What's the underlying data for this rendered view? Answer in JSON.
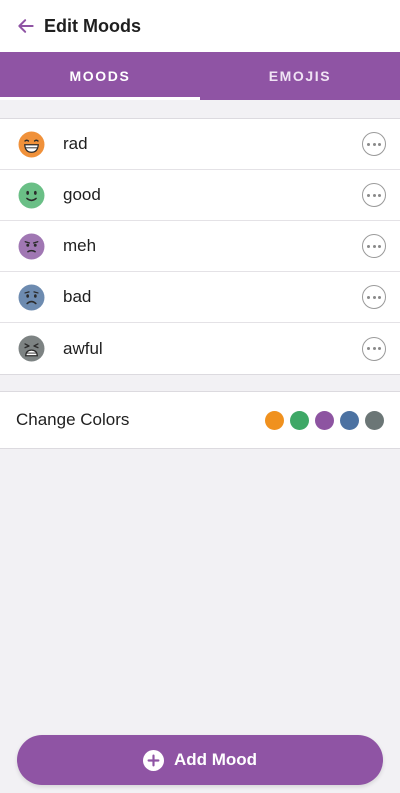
{
  "header": {
    "title": "Edit Moods",
    "back_icon": "arrow-left-icon",
    "accent": "#8f54a4"
  },
  "tabs": [
    {
      "label": "MOODS",
      "active": true
    },
    {
      "label": "EMOJIS",
      "active": false
    }
  ],
  "moods": [
    {
      "label": "rad",
      "icon": "grinning-face-icon",
      "color": "#f0913a"
    },
    {
      "label": "good",
      "icon": "smiling-face-icon",
      "color": "#6abf86"
    },
    {
      "label": "meh",
      "icon": "neutral-face-icon",
      "color": "#a077b3"
    },
    {
      "label": "bad",
      "icon": "frowning-face-icon",
      "color": "#6d8bb0"
    },
    {
      "label": "awful",
      "icon": "tired-face-icon",
      "color": "#7d8383"
    }
  ],
  "colors": {
    "label": "Change Colors",
    "swatches": [
      "#f0911e",
      "#3ea866",
      "#8d54a1",
      "#4c72a2",
      "#6b7676"
    ]
  },
  "add_button": {
    "label": "Add Mood",
    "icon": "plus-circle-icon"
  }
}
